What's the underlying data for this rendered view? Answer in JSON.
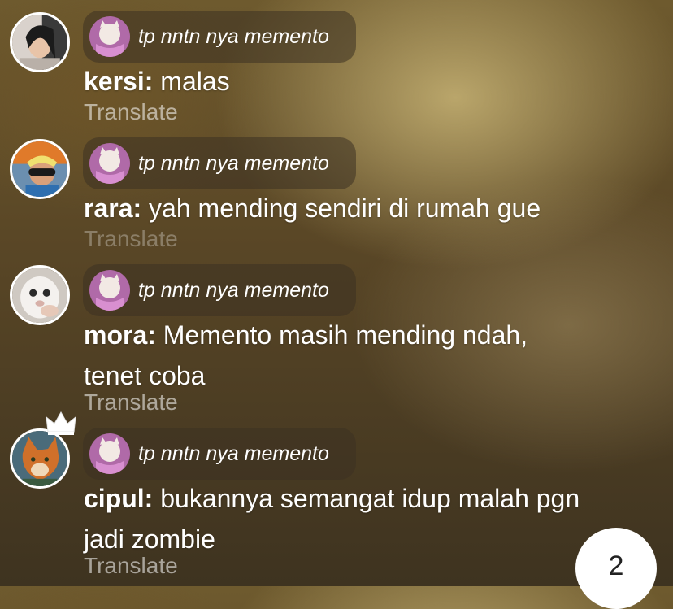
{
  "messages": [
    {
      "reply_text": "tp nntn nya memento",
      "username": "kersi:",
      "text": "malas",
      "translate": "Translate"
    },
    {
      "reply_text": "tp nntn nya memento",
      "username": "rara:",
      "text": "yah mending sendiri di rumah gue",
      "translate": "Translate"
    },
    {
      "reply_text": "tp nntn nya memento",
      "username": "mora:",
      "text": "Memento masih mending ndah, tenet coba",
      "translate": "Translate"
    },
    {
      "reply_text": "tp nntn nya memento",
      "username": "cipul:",
      "text": "bukannya semangat idup malah pgn jadi zombie",
      "translate": "Translate"
    }
  ],
  "unread_badge": "2",
  "icons": [
    "avatar-kersi",
    "avatar-rara",
    "avatar-mora",
    "avatar-cipul",
    "crown-icon",
    "reply-cat-thumbnail"
  ]
}
